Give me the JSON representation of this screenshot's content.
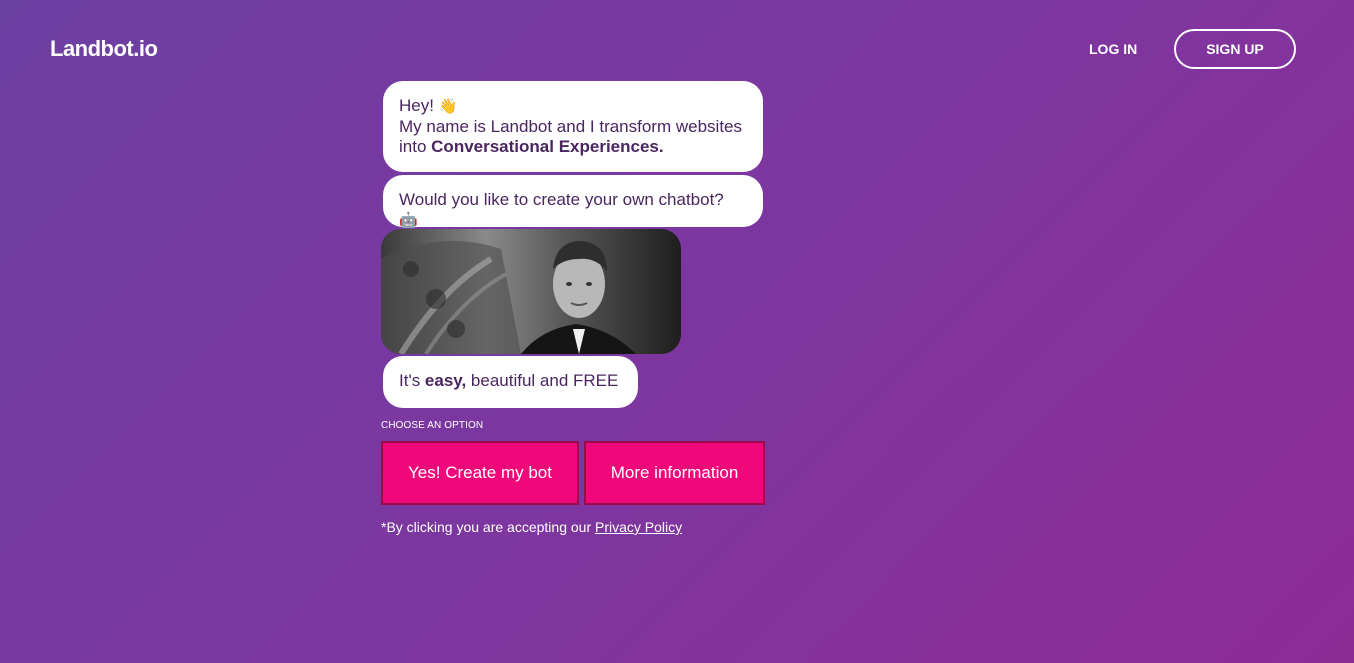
{
  "header": {
    "logo": "Landbot.io",
    "login_label": "LOG IN",
    "signup_label": "SIGN UP"
  },
  "chat": {
    "bubble1": {
      "line1": "Hey!",
      "line2": "My name is Landbot and I transform websites into",
      "bold": "Conversational Experiences.",
      "emoji_icon": "waving-hand-icon"
    },
    "bubble2": {
      "text": "Would you like to create your own chatbot?",
      "emoji_icon": "robot-icon"
    },
    "bubble4": {
      "prefix": "It's ",
      "bold": "easy,",
      "suffix": " beautiful and FREE"
    }
  },
  "options": {
    "label": "CHOOSE AN OPTION",
    "yes_label": "Yes! Create my bot",
    "more_label": "More information"
  },
  "footer": {
    "policy_text": "*By clicking you are accepting our ",
    "policy_link": "Privacy Policy"
  },
  "colors": {
    "background_start": "#6c3fa3",
    "background_end": "#8e2c96",
    "button": "#f0077a",
    "bubble_text": "#4a2660"
  }
}
